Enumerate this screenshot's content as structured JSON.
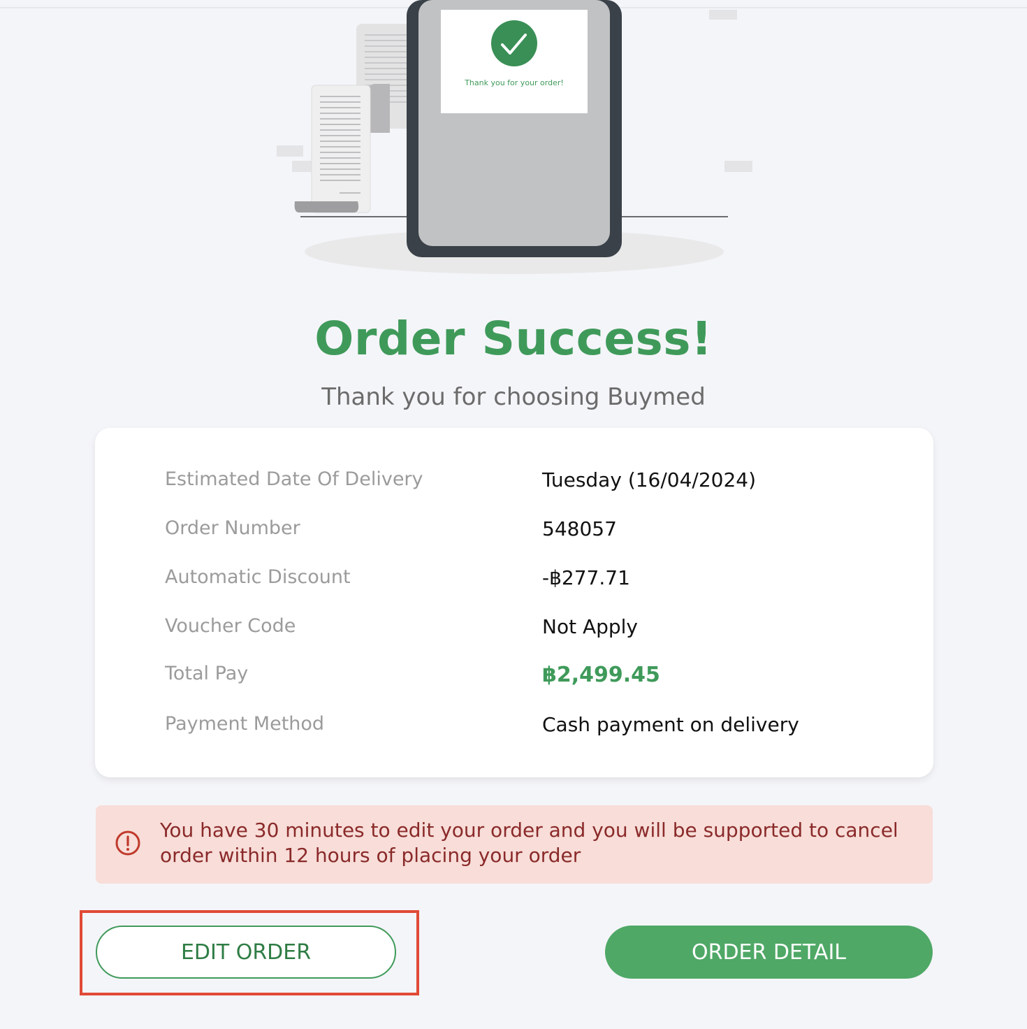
{
  "illustration": {
    "phone_message": "Thank you for your order!",
    "check_color": "#3a8f56"
  },
  "header": {
    "title": "Order Success!",
    "subtitle": "Thank you for choosing Buymed"
  },
  "summary": {
    "rows": [
      {
        "label": "Estimated Date Of Delivery",
        "value": "Tuesday (16/04/2024)"
      },
      {
        "label": "Order Number",
        "value": "548057"
      },
      {
        "label": "Automatic Discount",
        "value": "-฿277.71"
      },
      {
        "label": "Voucher Code",
        "value": "Not Apply"
      },
      {
        "label": "Total Pay",
        "value": "฿2,499.45"
      },
      {
        "label": "Payment Method",
        "value": "Cash payment on delivery"
      }
    ]
  },
  "notice": {
    "icon": "exclamation-circle-icon",
    "text": "You have 30 minutes to edit your order and you will be supported to cancel order within 12 hours of placing your order"
  },
  "actions": {
    "edit_label": "EDIT ORDER",
    "detail_label": "ORDER DETAIL"
  },
  "colors": {
    "brand_green": "#3f9a5a",
    "button_green": "#4fa866",
    "notice_bg": "#f8ddd8",
    "notice_text": "#8a2a2a",
    "highlight": "#e04a36"
  }
}
